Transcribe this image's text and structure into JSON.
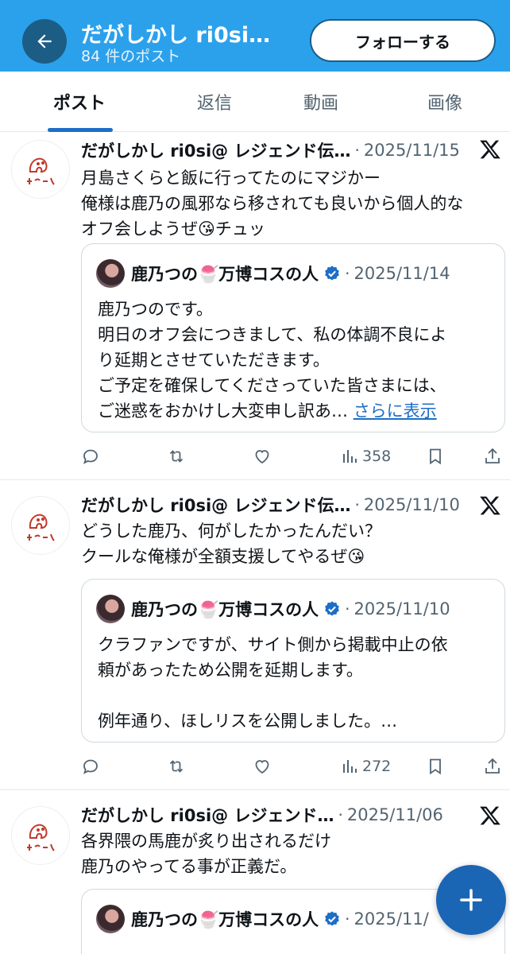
{
  "header": {
    "title": "だがしかし ri0si…",
    "subtitle": "84 件のポスト",
    "follow_label": "フォローする"
  },
  "tabs": [
    {
      "label": "ポスト",
      "active": true
    },
    {
      "label": "返信",
      "active": false
    },
    {
      "label": "動画",
      "active": false
    },
    {
      "label": "画像",
      "active": false
    }
  ],
  "posts": [
    {
      "author": "だがしかし ri0si@ レジェンド伝…",
      "date": "2025/11/15",
      "lines": [
        "月島さくらと飯に行ってたのにマジかー",
        "俺様は鹿乃の風邪なら移されても良いから個人的な",
        "オフ会しようぜ😘チュッ"
      ],
      "quote": {
        "name": "鹿乃つの🍧万博コスの人",
        "date": "2025/11/14",
        "lines": [
          "鹿乃つのです。",
          "明日のオフ会につきまして、私の体調不良によ",
          "り延期とさせていただきます。",
          "ご予定を確保してくださっていた皆さまには、",
          "ご迷惑をおかけし大変申し訳あ…"
        ],
        "more": "さらに表示"
      },
      "views": "358"
    },
    {
      "author": "だがしかし ri0si@ レジェンド伝…",
      "date": "2025/11/10",
      "lines": [
        "どうした鹿乃、何がしたかったんだい？",
        "クールな俺様が全額支援してやるぜ😘"
      ],
      "quote": {
        "name": "鹿乃つの🍧万博コスの人",
        "date": "2025/11/10",
        "lines": [
          "クラファンですが、サイト側から掲載中止の依",
          "頼があったため公開を延期します。",
          "",
          "例年通り、ほしリスを公開しました。…"
        ]
      },
      "views": "272"
    },
    {
      "author": "だがしかし ri0si@ レジェンド…",
      "date": "2025/11/06",
      "lines": [
        "各界隈の馬鹿が炙り出されるだけ",
        "鹿乃のやってる事が正義だ。"
      ],
      "quote": {
        "name": "鹿乃つの🍧万博コスの人",
        "date": "2025/11/"
      }
    }
  ],
  "icons": {
    "back": "arrow-left-icon",
    "x_logo": "x-logo-icon",
    "verified": "verified-badge-icon",
    "reply": "reply-icon",
    "repost": "repost-icon",
    "like": "heart-icon",
    "views": "bar-chart-icon",
    "bookmark": "bookmark-icon",
    "share": "share-icon",
    "compose": "plus-icon"
  },
  "colors": {
    "header_bg": "#2ba1ec",
    "accent": "#1d6ec6",
    "fab": "#1b65b5",
    "verified": "#1d6ec6"
  }
}
